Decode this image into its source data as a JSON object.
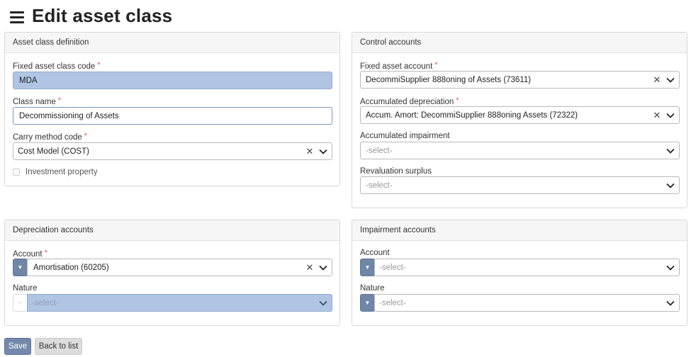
{
  "header": {
    "title": "Edit asset class"
  },
  "asset_class_definition": {
    "title": "Asset class definition",
    "code_label": "Fixed asset class code",
    "code_value": "MDA",
    "name_label": "Class name",
    "name_value": "Decommissioning of Assets",
    "carry_label": "Carry method code",
    "carry_value": "Cost Model (COST)",
    "investment_label": "Investment property"
  },
  "control_accounts": {
    "title": "Control accounts",
    "fixed_asset_label": "Fixed asset account",
    "fixed_asset_value": "DecommiSupplier 888oning of Assets (73611)",
    "acc_dep_label": "Accumulated depreciation",
    "acc_dep_value": "Accum. Amort: DecommiSupplier 888oning Assets (72322)",
    "acc_imp_label": "Accumulated impairment",
    "acc_imp_value": "-select-",
    "reval_label": "Revaluation surplus",
    "reval_value": "-select-"
  },
  "depreciation_accounts": {
    "title": "Depreciation accounts",
    "account_label": "Account",
    "account_value": "Amortisation (60205)",
    "nature_label": "Nature",
    "nature_prefix": "-",
    "nature_value": "-select-"
  },
  "impairment_accounts": {
    "title": "Impairment accounts",
    "account_label": "Account",
    "account_value": "-select-",
    "nature_label": "Nature",
    "nature_value": "-select-"
  },
  "actions": {
    "save": "Save",
    "back": "Back to list"
  },
  "icons": {
    "menu": "hamburger-menu-icon",
    "clear": "close-icon",
    "dropdown": "chevron-down-icon",
    "selector": "caret-down-icon"
  },
  "colors": {
    "readonly_fill": "#b0c5e3",
    "primary_button": "#7389ab",
    "required": "#e0574b"
  }
}
